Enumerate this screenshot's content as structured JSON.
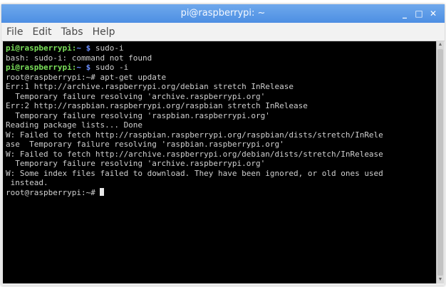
{
  "window": {
    "title": "pi@raspberrypi: ~",
    "controls": {
      "minimize": "_",
      "maximize": "□",
      "close": "✕"
    }
  },
  "menu": [
    "File",
    "Edit",
    "Tabs",
    "Help"
  ],
  "terminal": {
    "lines": [
      {
        "type": "prompt",
        "user": "pi@raspberrypi",
        "sep": ":",
        "path": "~",
        "sym": " $ ",
        "cmd": "sudo-i"
      },
      {
        "type": "out",
        "text": "bash: sudo-i: command not found"
      },
      {
        "type": "prompt",
        "user": "pi@raspberrypi",
        "sep": ":",
        "path": "~",
        "sym": " $ ",
        "cmd": "sudo -i"
      },
      {
        "type": "out",
        "text": "root@raspberrypi:~# apt-get update"
      },
      {
        "type": "out",
        "text": "Err:1 http://archive.raspberrypi.org/debian stretch InRelease"
      },
      {
        "type": "out",
        "text": "  Temporary failure resolving 'archive.raspberrypi.org'"
      },
      {
        "type": "out",
        "text": "Err:2 http://raspbian.raspberrypi.org/raspbian stretch InRelease"
      },
      {
        "type": "out",
        "text": "  Temporary failure resolving 'raspbian.raspberrypi.org'"
      },
      {
        "type": "out",
        "text": "Reading package lists... Done"
      },
      {
        "type": "out",
        "text": "W: Failed to fetch http://raspbian.raspberrypi.org/raspbian/dists/stretch/InRele"
      },
      {
        "type": "out",
        "text": "ase  Temporary failure resolving 'raspbian.raspberrypi.org'"
      },
      {
        "type": "out",
        "text": "W: Failed to fetch http://archive.raspberrypi.org/debian/dists/stretch/InRelease"
      },
      {
        "type": "out",
        "text": "  Temporary failure resolving 'archive.raspberrypi.org'"
      },
      {
        "type": "out",
        "text": "W: Some index files failed to download. They have been ignored, or old ones used"
      },
      {
        "type": "out",
        "text": " instead."
      },
      {
        "type": "cursor",
        "text": "root@raspberrypi:~# "
      }
    ]
  },
  "colors": {
    "titlebar": "#5b9ae8",
    "terminal_bg": "#000000",
    "user": "#7be05a",
    "path": "#6c8fff"
  }
}
